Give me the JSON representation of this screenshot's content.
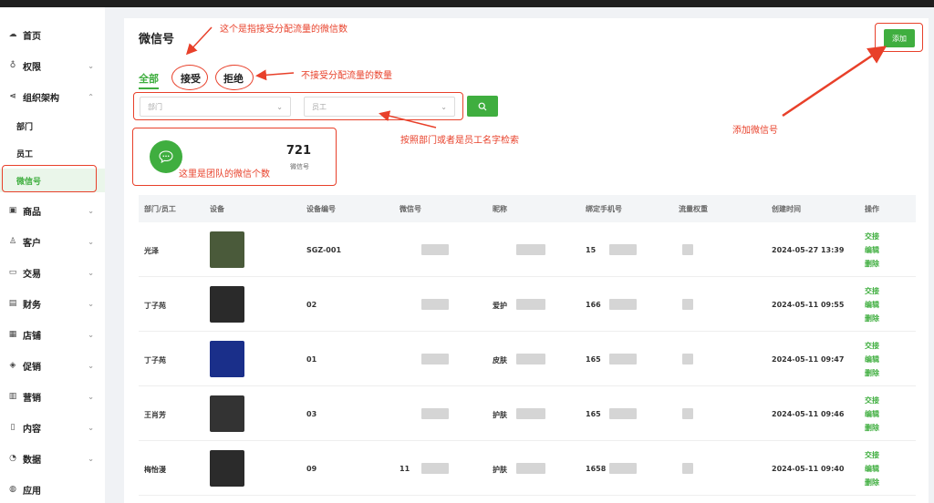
{
  "sidebar": {
    "items": [
      {
        "label": "首页",
        "icon": "cloud-icon"
      },
      {
        "label": "权限",
        "icon": "lock-icon"
      },
      {
        "label": "组织架构",
        "icon": "share-icon"
      },
      {
        "label": "部门"
      },
      {
        "label": "员工"
      },
      {
        "label": "微信号"
      },
      {
        "label": "商品",
        "icon": "box-icon"
      },
      {
        "label": "客户",
        "icon": "user-icon"
      },
      {
        "label": "交易",
        "icon": "folder-icon"
      },
      {
        "label": "财务",
        "icon": "wallet-icon"
      },
      {
        "label": "店铺",
        "icon": "store-icon"
      },
      {
        "label": "促销",
        "icon": "tag-icon"
      },
      {
        "label": "营销",
        "icon": "gift-icon"
      },
      {
        "label": "内容",
        "icon": "document-icon"
      },
      {
        "label": "数据",
        "icon": "pie-icon"
      },
      {
        "label": "应用",
        "icon": "app-icon"
      }
    ]
  },
  "page": {
    "title": "微信号",
    "add_label": "添加"
  },
  "tabs": [
    "全部",
    "接受",
    "拒绝"
  ],
  "filters": {
    "department_placeholder": "部门",
    "employee_placeholder": "员工"
  },
  "stat": {
    "value": "721",
    "label": "微信号"
  },
  "table": {
    "headers": [
      "部门/员工",
      "设备",
      "设备编号",
      "微信号",
      "昵称",
      "绑定手机号",
      "流量权重",
      "创建时间",
      "操作"
    ],
    "actions": [
      "交接",
      "编辑",
      "删除"
    ],
    "rows": [
      {
        "employee": "光泽",
        "device_no": "SGZ-001",
        "wechat": "",
        "nickname": "",
        "phone": "15",
        "created": "2024-05-27 13:39",
        "thumb": "#4a5a3a"
      },
      {
        "employee": "丁子苑",
        "device_no": "02",
        "wechat": "",
        "nickname": "爱护",
        "phone": "166",
        "created": "2024-05-11 09:55",
        "thumb": "#2a2a2a"
      },
      {
        "employee": "丁子苑",
        "device_no": "01",
        "wechat": "",
        "nickname": "皮肤",
        "phone": "165",
        "created": "2024-05-11 09:47",
        "thumb": "#1a2f8a"
      },
      {
        "employee": "王肖芳",
        "device_no": "03",
        "wechat": "",
        "nickname": "护肤",
        "phone": "165",
        "created": "2024-05-11 09:46",
        "thumb": "#333333"
      },
      {
        "employee": "梅怡漫",
        "device_no": "09",
        "wechat": "11",
        "nickname": "护肤",
        "phone": "1658",
        "created": "2024-05-11 09:40",
        "thumb": "#2b2b2b"
      }
    ]
  },
  "annotations": {
    "wechat_accept": "这个是指接受分配流量的微信数",
    "reject": "不接受分配流量的数量",
    "search_hint": "按照部门或者是员工名字检索",
    "add_hint": "添加微信号",
    "team_count": "这里是团队的微信个数"
  },
  "colors": {
    "accent": "#3fae3f",
    "annotation": "#e8402a"
  }
}
